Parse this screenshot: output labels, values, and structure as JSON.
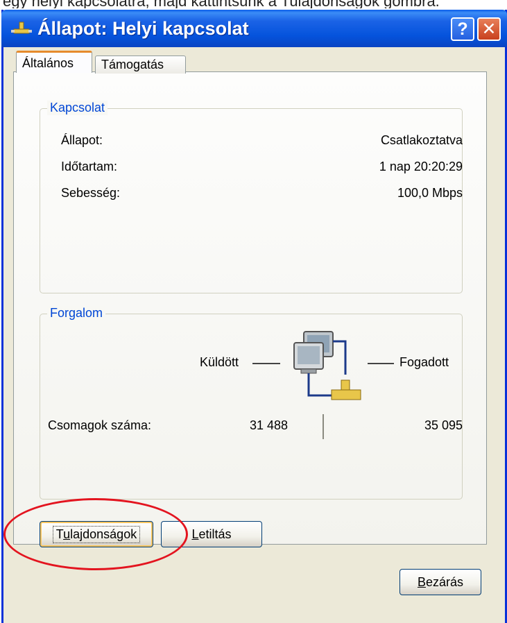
{
  "clipped_text": "egy helyi kapcsolatra, majd kattintsunk a Tulajdonságok gombra.",
  "window": {
    "title": "Állapot: Helyi kapcsolat",
    "help_label": "?",
    "close_label": "✕"
  },
  "tabs": [
    {
      "label": "Általános",
      "active": true
    },
    {
      "label": "Támogatás",
      "active": false
    }
  ],
  "connection": {
    "legend": "Kapcsolat",
    "rows": [
      {
        "label": "Állapot:",
        "value": "Csatlakoztatva"
      },
      {
        "label": "Időtartam:",
        "value": "1 nap 20:20:29"
      },
      {
        "label": "Sebesség:",
        "value": "100,0 Mbps"
      }
    ]
  },
  "traffic": {
    "legend": "Forgalom",
    "sent_label": "Küldött",
    "received_label": "Fogadott",
    "packets_label": "Csomagok száma:",
    "sent_value": "31 488",
    "received_value": "35 095"
  },
  "buttons": {
    "properties": {
      "prefix": "T",
      "accel": "u",
      "rest": "lajdonságok"
    },
    "disable": {
      "accel": "L",
      "rest": "etiltás"
    },
    "close": {
      "accel": "B",
      "rest": "ezárás"
    }
  },
  "colors": {
    "title_bar": "#0553dc",
    "group_legend": "#0046d5",
    "annotation": "#e3141f"
  }
}
